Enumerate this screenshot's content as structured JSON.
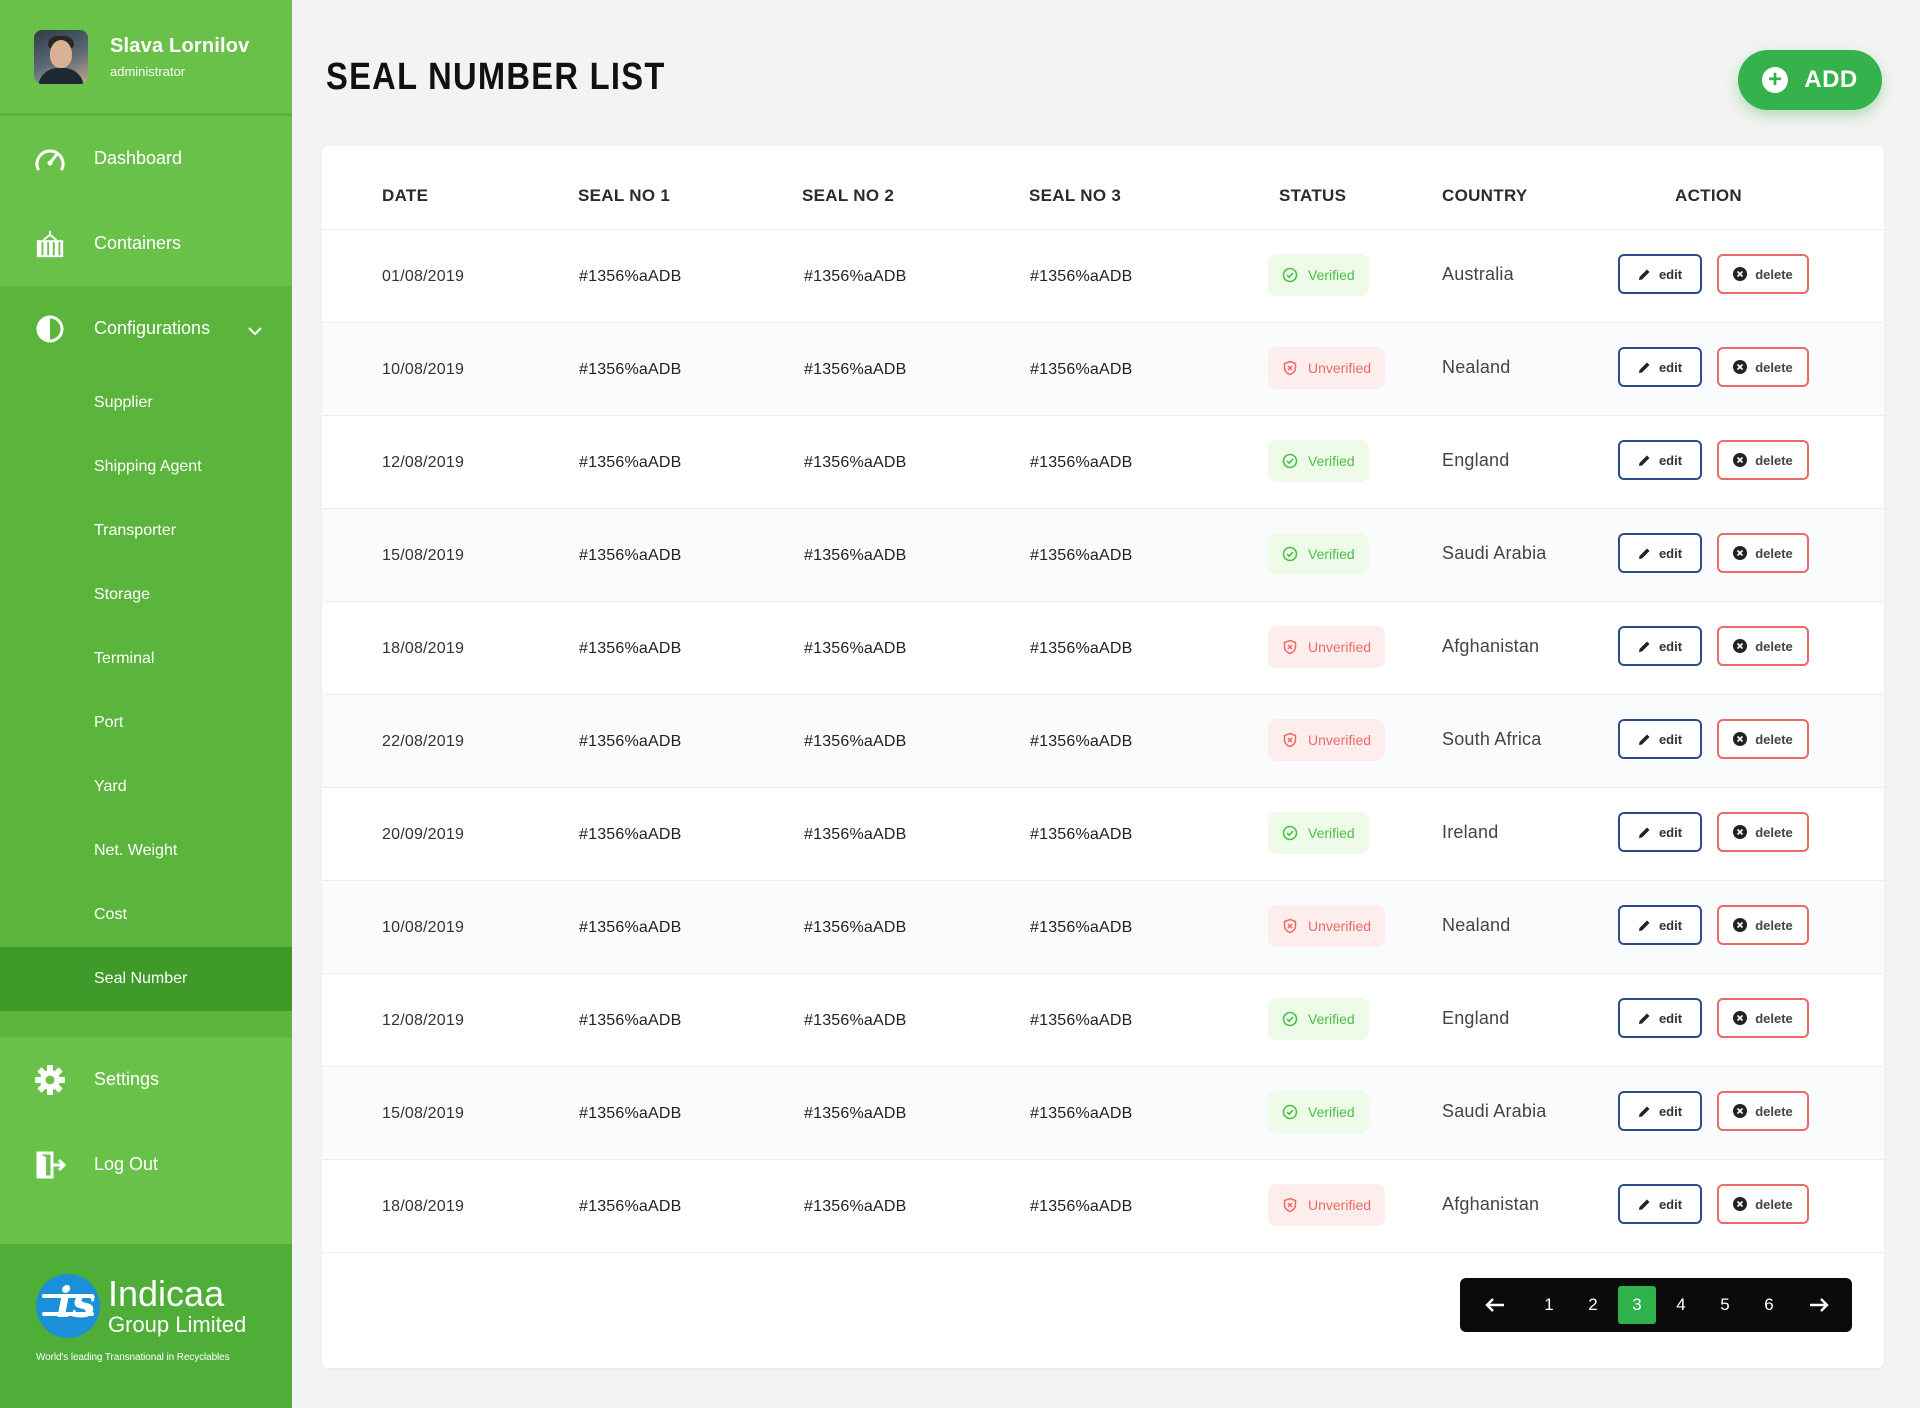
{
  "user": {
    "name": "Slava Lornilov",
    "role": "administrator"
  },
  "nav": {
    "dashboard": "Dashboard",
    "containers": "Containers",
    "configurations": "Configurations",
    "sub_items": [
      "Supplier",
      "Shipping Agent",
      "Transporter",
      "Storage",
      "Terminal",
      "Port",
      "Yard",
      "Net. Weight",
      "Cost",
      "Seal Number"
    ],
    "active_sub": "Seal Number",
    "settings": "Settings",
    "logout": "Log Out"
  },
  "brand": {
    "name": "Indicaa",
    "sub": "Group Limited",
    "tagline": "World's leading Transnational in Recyclables",
    "mark": "is"
  },
  "page": {
    "title": "SEAL NUMBER LIST",
    "add_label": "ADD"
  },
  "table": {
    "headers": {
      "date": "DATE",
      "seal1": "SEAL NO 1",
      "seal2": "SEAL NO 2",
      "seal3": "SEAL NO 3",
      "status": "STATUS",
      "country": "COUNTRY",
      "action": "ACTION"
    },
    "edit_label": "edit",
    "delete_label": "delete",
    "rows": [
      {
        "date": "01/08/2019",
        "seal1": "#1356%aADB",
        "seal2": "#1356%aADB",
        "seal3": "#1356%aADB",
        "status": "Verified",
        "country": "Australia"
      },
      {
        "date": "10/08/2019",
        "seal1": "#1356%aADB",
        "seal2": "#1356%aADB",
        "seal3": "#1356%aADB",
        "status": "Unverified",
        "country": "Nealand"
      },
      {
        "date": "12/08/2019",
        "seal1": "#1356%aADB",
        "seal2": "#1356%aADB",
        "seal3": "#1356%aADB",
        "status": "Verified",
        "country": "England"
      },
      {
        "date": "15/08/2019",
        "seal1": "#1356%aADB",
        "seal2": "#1356%aADB",
        "seal3": "#1356%aADB",
        "status": "Verified",
        "country": "Saudi Arabia"
      },
      {
        "date": "18/08/2019",
        "seal1": "#1356%aADB",
        "seal2": "#1356%aADB",
        "seal3": "#1356%aADB",
        "status": "Unverified",
        "country": "Afghanistan"
      },
      {
        "date": "22/08/2019",
        "seal1": "#1356%aADB",
        "seal2": "#1356%aADB",
        "seal3": "#1356%aADB",
        "status": "Unverified",
        "country": "South Africa"
      },
      {
        "date": "20/09/2019",
        "seal1": "#1356%aADB",
        "seal2": "#1356%aADB",
        "seal3": "#1356%aADB",
        "status": "Verified",
        "country": "Ireland"
      },
      {
        "date": "10/08/2019",
        "seal1": "#1356%aADB",
        "seal2": "#1356%aADB",
        "seal3": "#1356%aADB",
        "status": "Unverified",
        "country": "Nealand"
      },
      {
        "date": "12/08/2019",
        "seal1": "#1356%aADB",
        "seal2": "#1356%aADB",
        "seal3": "#1356%aADB",
        "status": "Verified",
        "country": "England"
      },
      {
        "date": "15/08/2019",
        "seal1": "#1356%aADB",
        "seal2": "#1356%aADB",
        "seal3": "#1356%aADB",
        "status": "Verified",
        "country": "Saudi Arabia"
      },
      {
        "date": "18/08/2019",
        "seal1": "#1356%aADB",
        "seal2": "#1356%aADB",
        "seal3": "#1356%aADB",
        "status": "Unverified",
        "country": "Afghanistan"
      }
    ]
  },
  "pagination": {
    "pages": [
      "1",
      "2",
      "3",
      "4",
      "5",
      "6"
    ],
    "current": "3"
  },
  "colors": {
    "sidebar": "#6ac14a",
    "sidebar_active": "#3f9a2a",
    "accent": "#36b24c",
    "verified": "#4cbf46",
    "unverified": "#ec6a64",
    "edit_border": "#2c4d8a"
  },
  "icons": {
    "dashboard": "gauge-icon",
    "containers": "container-icon",
    "configurations": "half-circle-icon",
    "settings": "gear-icon",
    "logout": "logout-icon"
  }
}
